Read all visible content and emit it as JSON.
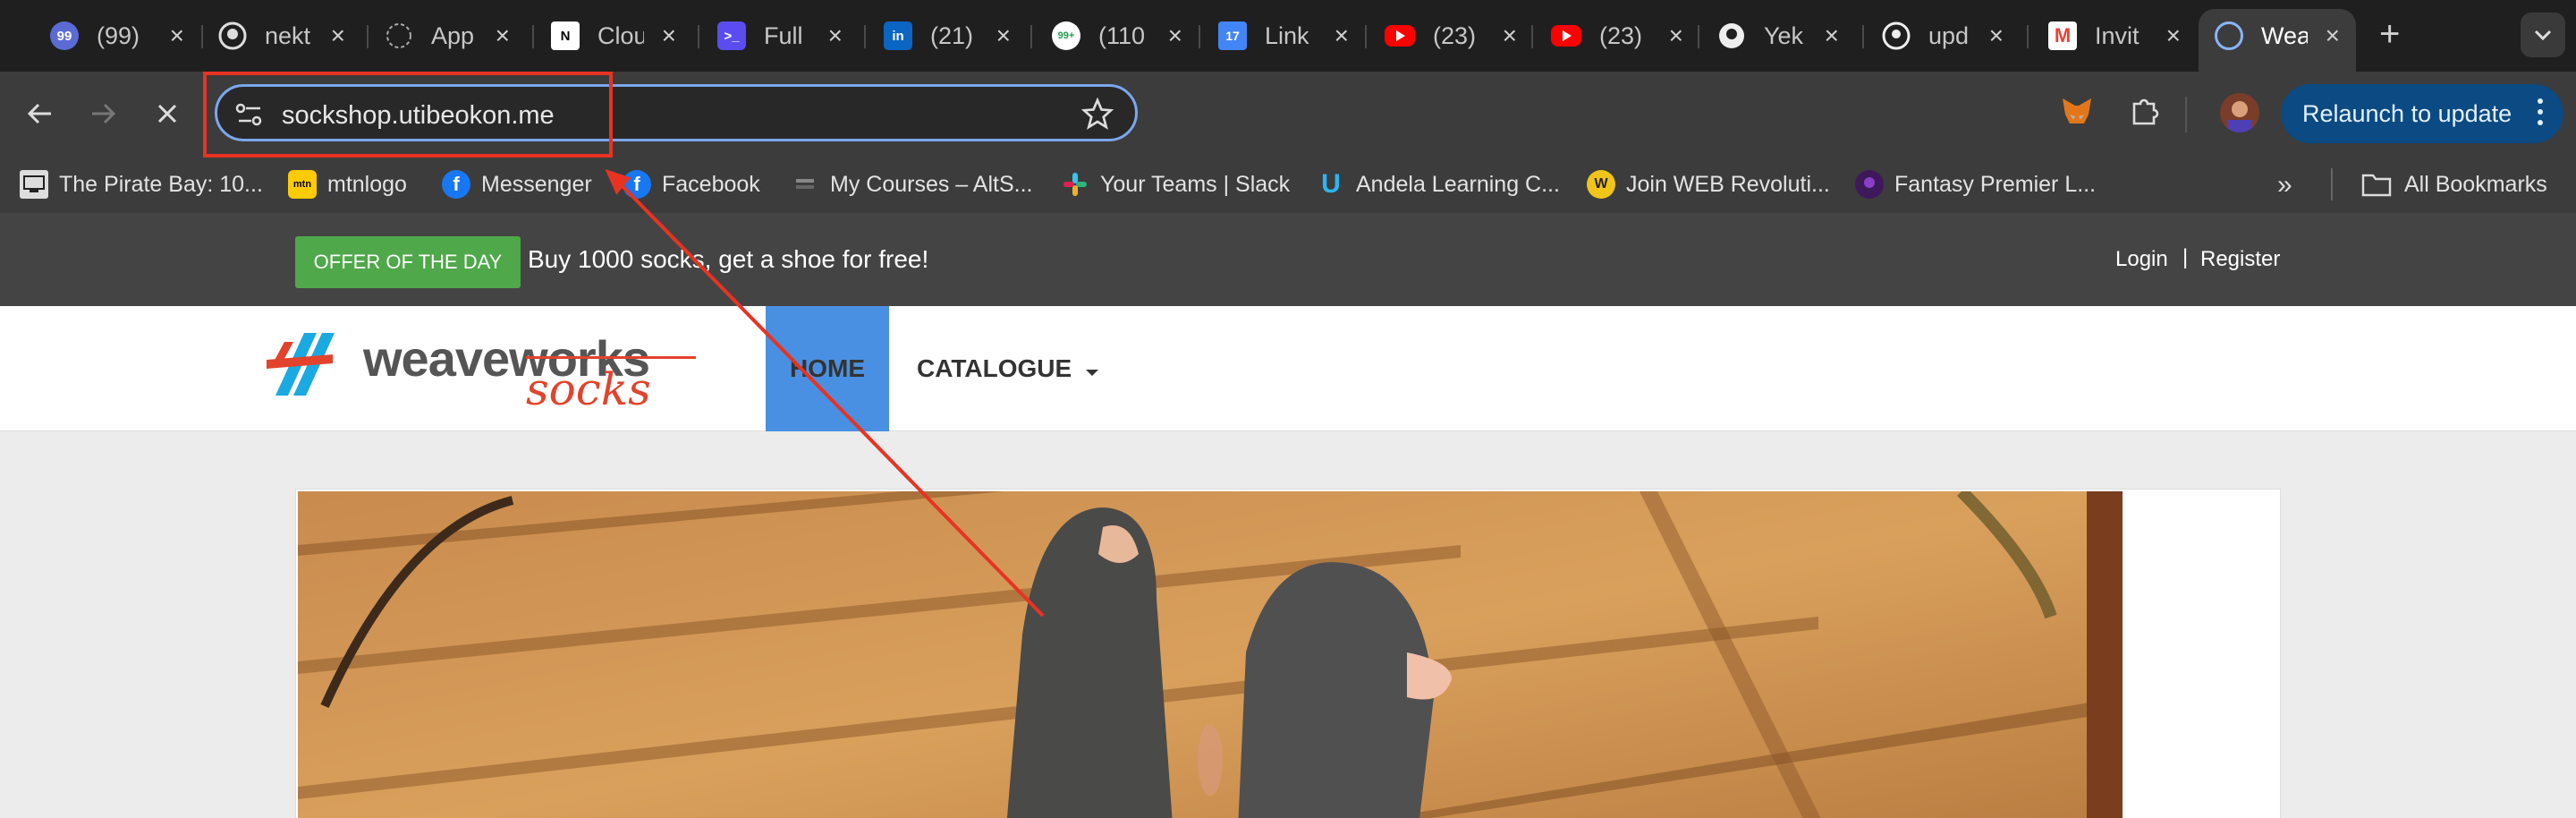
{
  "tabs": [
    {
      "title": "(99)",
      "icon": "notification-badge-icon",
      "badge": "99"
    },
    {
      "title": "nekt",
      "icon": "github-icon"
    },
    {
      "title": "App",
      "icon": "loading-spinner-icon"
    },
    {
      "title": "Clou",
      "icon": "notion-icon",
      "glyph": "N"
    },
    {
      "title": "Full",
      "icon": "terminal-icon",
      "glyph": ">_"
    },
    {
      "title": "(21)",
      "icon": "linkedin-icon",
      "glyph": "in"
    },
    {
      "title": "(110",
      "icon": "whatsapp-icon",
      "glyph": "99+"
    },
    {
      "title": "Link",
      "icon": "calendar-icon",
      "glyph": "17"
    },
    {
      "title": "(23)",
      "icon": "youtube-icon"
    },
    {
      "title": "(23)",
      "icon": "youtube-icon"
    },
    {
      "title": "Yek",
      "icon": "github-icon"
    },
    {
      "title": "upd",
      "icon": "github-icon"
    },
    {
      "title": "Invit",
      "icon": "gmail-icon",
      "glyph": "M"
    },
    {
      "title": "Wea",
      "icon": "weaveworks-favicon-icon"
    }
  ],
  "toolbar": {
    "url": "sockshop.utibeokon.me",
    "relaunch_label": "Relaunch to update"
  },
  "bookmarks": [
    {
      "label": "The Pirate Bay: 10...",
      "icon": "pirate-ship-icon"
    },
    {
      "label": "mtnlogo",
      "icon": "mtn-icon",
      "glyph": "mtn"
    },
    {
      "label": "Messenger",
      "icon": "facebook-icon",
      "glyph": "f"
    },
    {
      "label": "Facebook",
      "icon": "facebook-icon",
      "glyph": "f"
    },
    {
      "label": "My Courses – AltS...",
      "icon": "altschool-icon"
    },
    {
      "label": "Your Teams | Slack",
      "icon": "slack-icon"
    },
    {
      "label": "Andela Learning C...",
      "icon": "andela-icon",
      "glyph": "U"
    },
    {
      "label": "Join WEB Revoluti...",
      "icon": "web3-icon",
      "glyph": "W"
    },
    {
      "label": "Fantasy Premier L...",
      "icon": "premier-league-icon"
    }
  ],
  "all_bookmarks_label": "All Bookmarks",
  "page": {
    "offer_badge": "OFFER OF THE DAY",
    "offer_text": "Buy 1000 socks, get a shoe for free!",
    "login": "Login",
    "separator": "|",
    "register": "Register",
    "logo_main": "weaveworks",
    "logo_sub": "socks",
    "nav_home": "HOME",
    "nav_catalogue": "CATALOGUE"
  },
  "colors": {
    "chrome_bg": "#1f1f1f",
    "toolbar_bg": "#3c3c3c",
    "omnibox_border": "#7ca6ee",
    "relaunch_bg": "#0b4a82",
    "offer_green": "#4fa84a",
    "home_blue": "#4a90e2",
    "annotation_red": "#e83323"
  }
}
